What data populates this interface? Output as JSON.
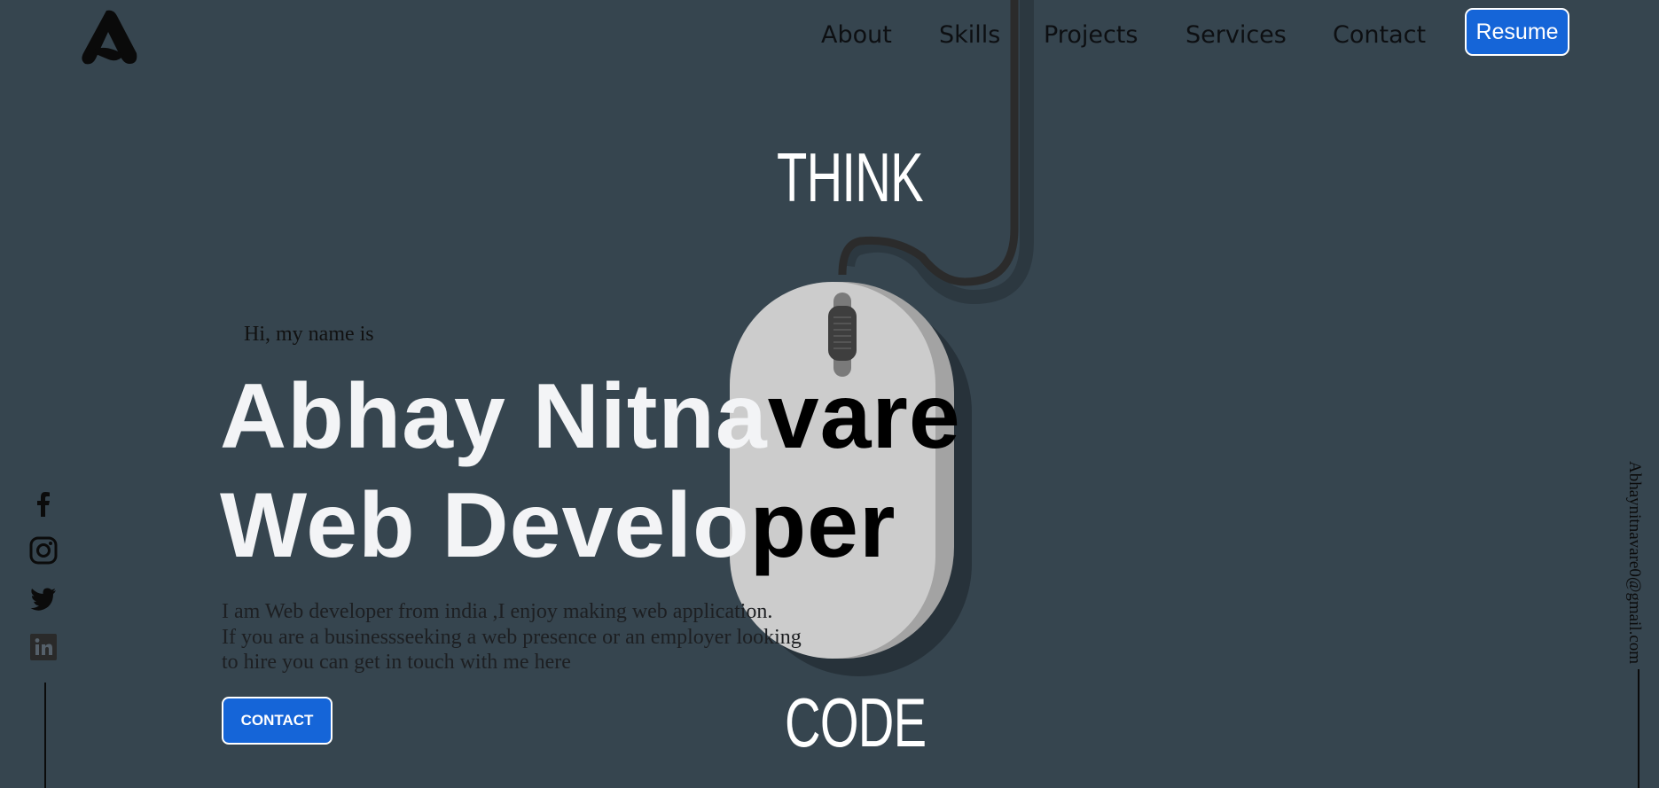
{
  "brand": {
    "logo_letter": "A"
  },
  "nav": {
    "items": [
      "About",
      "Skills",
      "Projects",
      "Services",
      "Contact"
    ],
    "resume_label": "Resume"
  },
  "hero": {
    "illustration_top_text": "THINK",
    "illustration_bottom_text": "CODE",
    "greeting": "Hi, my name is",
    "name_light": "Abhay Nitna",
    "name_dark": "vare",
    "role_light": "Web Develo",
    "role_dark": "per",
    "intro_line_1": "I am Web developer from india ,I enjoy making web application.",
    "intro_line_2": "If you are a businessseeking a web presence or an employer looking",
    "intro_line_3": "to hire you can get in touch with me here",
    "contact_label": "CONTACT"
  },
  "social": [
    "facebook-icon",
    "instagram-icon",
    "twitter-icon",
    "linkedin-icon"
  ],
  "side_email": "Abhaynitnavare0@gmail.com",
  "colors": {
    "background": "#36454f",
    "accent": "#1565d8",
    "text_light": "#f3f4f6"
  }
}
